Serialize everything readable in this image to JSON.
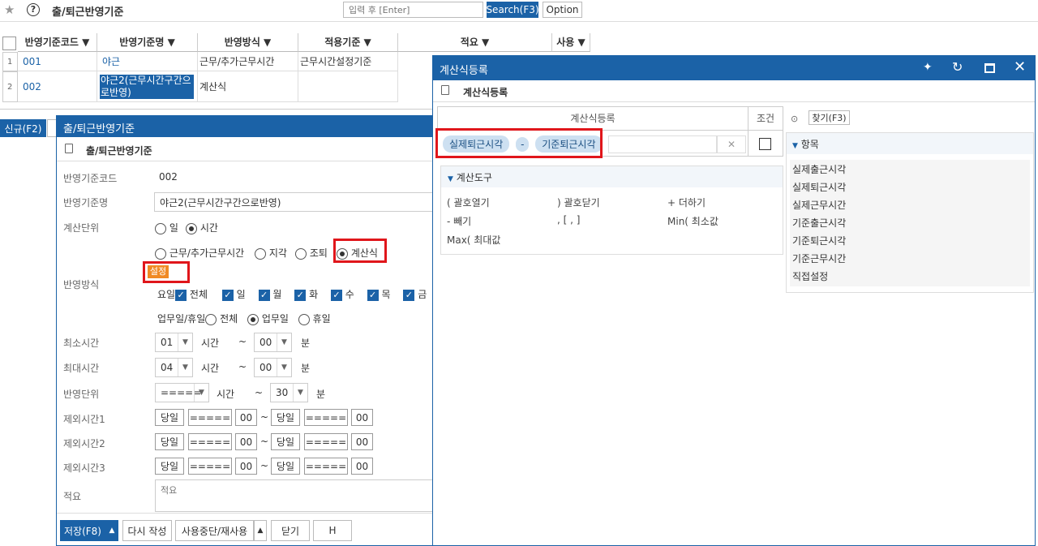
{
  "topbar": {
    "title": "출/퇴근반영기준",
    "search_placeholder": "입력 후 [Enter]",
    "search_label": "Search(F3)",
    "option_label": "Option"
  },
  "grid": {
    "columns": [
      "반영기준코드",
      "반영기준명",
      "반영방식",
      "적용기준",
      "적요",
      "사용"
    ],
    "rows": [
      {
        "num": "1",
        "code": "001",
        "name": "야근",
        "method": "근무/추가근무시간",
        "basis": "근무시간설정기준"
      },
      {
        "num": "2",
        "code": "002",
        "name": "야근2(근무시간구간으로반영)",
        "method": "계산식",
        "basis": ""
      }
    ],
    "new_label": "신규(F2)"
  },
  "form": {
    "window_title": "출/퇴근반영기준",
    "section_title": "출/퇴근반영기준",
    "labels": {
      "code": "반영기준코드",
      "name": "반영기준명",
      "unit": "계산단위",
      "method": "반영방식",
      "min": "최소시간",
      "max": "최대시간",
      "reflect_unit": "반영단위",
      "ex1": "제외시간1",
      "ex2": "제외시간2",
      "ex3": "제외시간3",
      "memo": "적요"
    },
    "code_value": "002",
    "name_value": "야근2(근무시간구간으로반영)",
    "unit_opts": {
      "day": "일",
      "time": "시간"
    },
    "method_opts": {
      "work": "근무/추가근무시간",
      "late": "지각",
      "early": "조퇴",
      "formula": "계산식"
    },
    "setting_label": "설정",
    "days": {
      "prefix": "요일",
      "all": "전체",
      "sun": "일",
      "mon": "월",
      "tue": "화",
      "wed": "수",
      "thu": "목",
      "fri": "금"
    },
    "workday": {
      "prefix": "업무일/휴일",
      "all": "전체",
      "work": "업무일",
      "holiday": "휴일"
    },
    "min_time": {
      "hour": "01",
      "hour_unit": "시간",
      "tilde": "~",
      "minute": "00",
      "minute_unit": "분"
    },
    "max_time": {
      "hour": "04",
      "hour_unit": "시간",
      "tilde": "~",
      "minute": "00",
      "minute_unit": "분"
    },
    "reflect": {
      "sel": "=====",
      "unit": "시간",
      "tilde": "~",
      "value": "30",
      "minute_unit": "분"
    },
    "excl": {
      "day": "당일",
      "dash": "=====",
      "zero": "00",
      "tilde": "~"
    },
    "memo_placeholder": "적요",
    "buttons": {
      "save": "저장(F8)",
      "rewrite": "다시 작성",
      "stop": "사용중단/재사용",
      "close": "닫기",
      "h": "H"
    }
  },
  "calc": {
    "window_title": "계산식등록",
    "section_title": "계산식등록",
    "header": "계산식등록",
    "condition_header": "조건",
    "tokens": [
      "실제퇴근시각",
      "-",
      "기준퇴근시각"
    ],
    "tools_title": "계산도구",
    "tools": [
      "( 괄호열기",
      ") 괄호닫기",
      "+ 더하기",
      "- 빼기",
      ", [ , ]",
      "Min( 최소값",
      "Max( 최대값"
    ],
    "find_label": "찾기(F3)",
    "items_title": "항목",
    "items": [
      "실제출근시각",
      "실제퇴근시각",
      "실제근무시간",
      "기준출근시각",
      "기준퇴근시각",
      "기준근무시간",
      "직접설정"
    ]
  },
  "colors": {
    "primary": "#1b62a7",
    "highlight": "#e0161b",
    "token": "#cde0f1",
    "orange": "#f08a24"
  }
}
